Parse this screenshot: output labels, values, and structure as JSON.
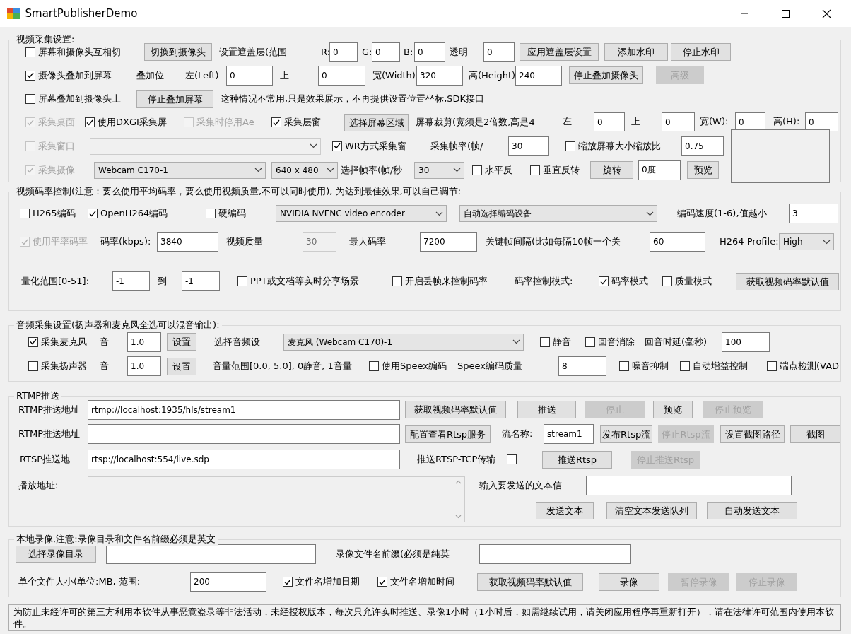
{
  "window": {
    "title": "SmartPublisherDemo"
  },
  "sections": [
    {
      "title": "视频采集设置:",
      "rows": [
        {
          "controls": [
            {
              "kind": "checkbox",
              "label": "屏幕和摄像头互相切",
              "checked": false,
              "disabled": false
            },
            {
              "kind": "button",
              "label": "切换到摄像头",
              "disabled": false
            },
            {
              "kind": "label",
              "text": "设置遮盖层(范围"
            },
            {
              "kind": "label",
              "text": "R:"
            },
            {
              "kind": "input",
              "value": "0",
              "disabled": false
            },
            {
              "kind": "label",
              "text": "G:"
            },
            {
              "kind": "input",
              "value": "0",
              "disabled": false
            },
            {
              "kind": "label",
              "text": "B:"
            },
            {
              "kind": "input",
              "value": "0",
              "disabled": false
            },
            {
              "kind": "label",
              "text": "透明"
            },
            {
              "kind": "input",
              "value": "0",
              "disabled": false
            },
            {
              "kind": "button",
              "label": "应用遮盖层设置",
              "disabled": false
            },
            {
              "kind": "button",
              "label": "添加水印",
              "disabled": false
            },
            {
              "kind": "button",
              "label": "停止水印",
              "disabled": false
            }
          ]
        },
        {
          "controls": [
            {
              "kind": "checkbox",
              "label": "摄像头叠加到屏幕",
              "checked": true,
              "disabled": false
            },
            {
              "kind": "label",
              "text": "叠加位"
            },
            {
              "kind": "label",
              "text": "左(Left)"
            },
            {
              "kind": "input",
              "value": "0",
              "disabled": false
            },
            {
              "kind": "label",
              "text": "上"
            },
            {
              "kind": "input",
              "value": "0",
              "disabled": false
            },
            {
              "kind": "label",
              "text": "宽(Width)"
            },
            {
              "kind": "input",
              "value": "320",
              "disabled": false
            },
            {
              "kind": "label",
              "text": "高(Height)"
            },
            {
              "kind": "input",
              "value": "240",
              "disabled": false
            },
            {
              "kind": "button",
              "label": "停止叠加摄像头",
              "disabled": false
            },
            {
              "kind": "button",
              "label": "高级",
              "disabled": true
            }
          ]
        },
        {
          "controls": [
            {
              "kind": "checkbox",
              "label": "屏幕叠加到摄像头上",
              "checked": false,
              "disabled": false
            },
            {
              "kind": "button",
              "label": "停止叠加屏幕",
              "disabled": false
            },
            {
              "kind": "label",
              "text": "这种情况不常用,只是效果展示，不再提供设置位置坐标,SDK接口"
            }
          ]
        },
        {
          "controls": [
            {
              "kind": "checkbox",
              "label": "采集桌面",
              "checked": true,
              "disabled": true
            },
            {
              "kind": "checkbox",
              "label": "使用DXGI采集屏",
              "checked": true,
              "disabled": false
            },
            {
              "kind": "checkbox",
              "label": "采集时停用Ae",
              "checked": false,
              "disabled": true
            },
            {
              "kind": "checkbox",
              "label": "采集层窗",
              "checked": true,
              "disabled": false
            },
            {
              "kind": "button",
              "label": "选择屏幕区域",
              "disabled": false
            },
            {
              "kind": "label",
              "text": "屏幕裁剪(宽须是2倍数,高是4"
            },
            {
              "kind": "label",
              "text": "左"
            },
            {
              "kind": "input",
              "value": "0",
              "disabled": false
            },
            {
              "kind": "label",
              "text": "上"
            },
            {
              "kind": "input",
              "value": "0",
              "disabled": false
            },
            {
              "kind": "label",
              "text": "宽(W):"
            },
            {
              "kind": "input",
              "value": "0",
              "disabled": false
            },
            {
              "kind": "label",
              "text": "高(H):"
            },
            {
              "kind": "input",
              "value": "0",
              "disabled": false
            }
          ]
        },
        {
          "controls": [
            {
              "kind": "checkbox",
              "label": "采集窗口",
              "checked": false,
              "disabled": true
            },
            {
              "kind": "combo",
              "disabled": true
            },
            {
              "kind": "checkbox",
              "label": "WR方式采集窗",
              "checked": true,
              "disabled": false
            },
            {
              "kind": "label",
              "text": "采集帧率(帧/"
            },
            {
              "kind": "input",
              "value": "30",
              "disabled": false
            },
            {
              "kind": "checkbox",
              "label": "缩放屏幕大小缩放比",
              "checked": false,
              "disabled": false
            },
            {
              "kind": "input",
              "value": "0.75",
              "disabled": false
            },
            {
              "kind": "frame"
            }
          ]
        },
        {
          "controls": [
            {
              "kind": "checkbox",
              "label": "采集摄像",
              "checked": true,
              "disabled": true
            },
            {
              "kind": "combo",
              "value": "Webcam C170-1",
              "disabled": false
            },
            {
              "kind": "combo",
              "value": "640 x 480",
              "disabled": false
            },
            {
              "kind": "label",
              "text": "选择帧率(帧/秒"
            },
            {
              "kind": "combo",
              "value": "30",
              "disabled": false
            },
            {
              "kind": "checkbox",
              "label": "水平反",
              "checked": false,
              "disabled": false
            },
            {
              "kind": "checkbox",
              "label": "垂直反转",
              "checked": false,
              "disabled": false
            },
            {
              "kind": "button",
              "label": "旋转",
              "disabled": false
            },
            {
              "kind": "input",
              "value": "0度",
              "disabled": false
            },
            {
              "kind": "button",
              "label": "预览",
              "disabled": false
            }
          ]
        }
      ]
    },
    {
      "title": "视频码率控制(注意：要么使用平均码率，要么使用视频质量,不可以同时使用), 为达到最佳效果,可以自己调节:",
      "rows": [
        {
          "controls": [
            {
              "kind": "checkbox",
              "label": "H265编码",
              "checked": false,
              "disabled": false
            },
            {
              "kind": "checkbox",
              "label": "OpenH264编码",
              "checked": true,
              "disabled": false
            },
            {
              "kind": "checkbox",
              "label": "硬编码",
              "checked": false,
              "disabled": false
            },
            {
              "kind": "combo",
              "value": "NVIDIA NVENC video encoder",
              "disabled": false
            },
            {
              "kind": "combo",
              "value": "自动选择编码设备",
              "disabled": false
            },
            {
              "kind": "label",
              "text": "编码速度(1-6),值越小"
            },
            {
              "kind": "input",
              "value": "3",
              "disabled": false
            }
          ]
        },
        {
          "controls": [
            {
              "kind": "checkbox",
              "label": "使用平率码率",
              "checked": true,
              "disabled": true
            },
            {
              "kind": "label",
              "text": "码率(kbps):"
            },
            {
              "kind": "input",
              "value": "3840",
              "disabled": false
            },
            {
              "kind": "label",
              "text": "视频质量"
            },
            {
              "kind": "input",
              "value": "30",
              "disabled": true
            },
            {
              "kind": "label",
              "text": "最大码率"
            },
            {
              "kind": "input",
              "value": "7200",
              "disabled": false
            },
            {
              "kind": "label",
              "text": "关键帧间隔(比如每隔10帧一个关"
            },
            {
              "kind": "input",
              "value": "60",
              "disabled": false
            },
            {
              "kind": "label",
              "text": "H264 Profile:"
            },
            {
              "kind": "combo",
              "value": "High",
              "disabled": false
            }
          ]
        },
        {
          "controls": [
            {
              "kind": "label",
              "text": "量化范围[0-51]:"
            },
            {
              "kind": "input",
              "value": "-1",
              "disabled": false
            },
            {
              "kind": "label",
              "text": "到"
            },
            {
              "kind": "input",
              "value": "-1",
              "disabled": false
            },
            {
              "kind": "checkbox",
              "label": "PPT或文档等实时分享场景",
              "checked": false,
              "disabled": false
            },
            {
              "kind": "checkbox",
              "label": "开启丢帧来控制码率",
              "checked": false,
              "disabled": false
            },
            {
              "kind": "label",
              "text": "码率控制模式:"
            },
            {
              "kind": "checkbox",
              "label": "码率模式",
              "checked": true,
              "disabled": false
            },
            {
              "kind": "checkbox",
              "label": "质量模式",
              "checked": false,
              "disabled": false
            },
            {
              "kind": "button",
              "label": "获取视频码率默认值",
              "disabled": false
            }
          ]
        }
      ]
    },
    {
      "title": "音频采集设置(扬声器和麦克风全选可以混音输出):",
      "rows": [
        {
          "controls": [
            {
              "kind": "checkbox",
              "label": "采集麦克风",
              "checked": true,
              "disabled": false
            },
            {
              "kind": "label",
              "text": "音"
            },
            {
              "kind": "input",
              "value": "1.0",
              "disabled": false
            },
            {
              "kind": "button",
              "label": "设置",
              "disabled": false
            },
            {
              "kind": "label",
              "text": "选择音频设"
            },
            {
              "kind": "combo",
              "value": "麦克风 (Webcam C170)-1",
              "disabled": false
            },
            {
              "kind": "checkbox",
              "label": "静音",
              "checked": false,
              "disabled": false
            },
            {
              "kind": "checkbox",
              "label": "回音消除",
              "checked": false,
              "disabled": false
            },
            {
              "kind": "label",
              "text": "回音时延(毫秒)"
            },
            {
              "kind": "input",
              "value": "100",
              "disabled": false
            }
          ]
        },
        {
          "controls": [
            {
              "kind": "checkbox",
              "label": "采集扬声器",
              "checked": false,
              "disabled": false
            },
            {
              "kind": "label",
              "text": "音"
            },
            {
              "kind": "input",
              "value": "1.0",
              "disabled": false
            },
            {
              "kind": "button",
              "label": "设置",
              "disabled": false
            },
            {
              "kind": "label",
              "text": "音量范围[0.0, 5.0], 0静音, 1音量"
            },
            {
              "kind": "checkbox",
              "label": "使用Speex编码",
              "checked": false,
              "disabled": false
            },
            {
              "kind": "label",
              "text": "Speex编码质量"
            },
            {
              "kind": "input",
              "value": "8",
              "disabled": false
            },
            {
              "kind": "checkbox",
              "label": "噪音抑制",
              "checked": false,
              "disabled": false
            },
            {
              "kind": "checkbox",
              "label": "自动增益控制",
              "checked": false,
              "disabled": false
            },
            {
              "kind": "checkbox",
              "label": "端点检测(VAD",
              "checked": false,
              "disabled": false
            }
          ]
        }
      ]
    },
    {
      "title": "RTMP推送",
      "rows": [
        {
          "controls": [
            {
              "kind": "label",
              "text": "RTMP推送地址"
            },
            {
              "kind": "input",
              "value": "rtmp://localhost:1935/hls/stream1",
              "disabled": false
            },
            {
              "kind": "button",
              "label": "获取视频码率默认值",
              "disabled": false
            },
            {
              "kind": "button",
              "label": "推送",
              "disabled": false
            },
            {
              "kind": "button",
              "label": "停止",
              "disabled": true
            },
            {
              "kind": "button",
              "label": "预览",
              "disabled": false
            },
            {
              "kind": "button",
              "label": "停止预览",
              "disabled": true
            }
          ]
        },
        {
          "controls": [
            {
              "kind": "label",
              "text": "RTMP推送地址"
            },
            {
              "kind": "input",
              "disabled": false
            },
            {
              "kind": "button",
              "label": "配置查看Rtsp服务",
              "disabled": false
            },
            {
              "kind": "label",
              "text": "流名称:"
            },
            {
              "kind": "input",
              "value": "stream1",
              "disabled": false
            },
            {
              "kind": "button",
              "label": "发布Rtsp流",
              "disabled": false
            },
            {
              "kind": "button",
              "label": "停止Rtsp流",
              "disabled": true
            },
            {
              "kind": "button",
              "label": "设置截图路径",
              "disabled": false
            },
            {
              "kind": "button",
              "label": "截图",
              "disabled": false
            }
          ]
        },
        {
          "controls": [
            {
              "kind": "label",
              "text": "RTSP推送地"
            },
            {
              "kind": "input",
              "value": "rtsp://localhost:554/live.sdp",
              "disabled": false
            },
            {
              "kind": "label",
              "text": "推送RTSP-TCP传输"
            },
            {
              "kind": "checkbox",
              "checked": false,
              "disabled": false
            },
            {
              "kind": "button",
              "label": "推送Rtsp",
              "disabled": false
            },
            {
              "kind": "button",
              "label": "停止推送Rtsp",
              "disabled": true
            }
          ]
        },
        {
          "controls": [
            {
              "kind": "label",
              "text": "播放地址:"
            },
            {
              "kind": "textarea"
            },
            {
              "kind": "label",
              "text": "输入要发送的文本信"
            },
            {
              "kind": "input",
              "disabled": false
            }
          ]
        },
        {
          "controls": [
            {
              "kind": "button",
              "label": "发送文本",
              "disabled": false
            },
            {
              "kind": "button",
              "label": "清空文本发送队列",
              "disabled": false
            },
            {
              "kind": "button",
              "label": "自动发送文本",
              "disabled": false
            }
          ]
        }
      ]
    },
    {
      "title": "本地录像,注意:录像目录和文件名前缀必须是英文",
      "rows": [
        {
          "controls": [
            {
              "kind": "button",
              "label": "选择录像目录",
              "disabled": false
            },
            {
              "kind": "input",
              "disabled": false
            },
            {
              "kind": "label",
              "text": "录像文件名前缀(必须是纯英"
            },
            {
              "kind": "input",
              "disabled": false
            }
          ]
        },
        {
          "controls": [
            {
              "kind": "label",
              "text": "单个文件大小(单位:MB, 范围:"
            },
            {
              "kind": "input",
              "value": "200",
              "disabled": false
            },
            {
              "kind": "checkbox",
              "label": "文件名增加日期",
              "checked": true,
              "disabled": false
            },
            {
              "kind": "checkbox",
              "label": "文件名增加时间",
              "checked": true,
              "disabled": false
            },
            {
              "kind": "button",
              "label": "获取视频码率默认值",
              "disabled": false
            },
            {
              "kind": "button",
              "label": "录像",
              "disabled": false
            },
            {
              "kind": "button",
              "label": "暂停录像",
              "disabled": true
            },
            {
              "kind": "button",
              "label": "停止录像",
              "disabled": true
            }
          ]
        }
      ]
    }
  ],
  "notice": "为防止未经许可的第三方利用本软件从事恶意盗录等非法活动，未经授权版本，每次只允许实时推送、录像1小时（1小时后，如需继续试用，请关闭应用程序再重新打开），请在法律许可范围内使用本软件。"
}
